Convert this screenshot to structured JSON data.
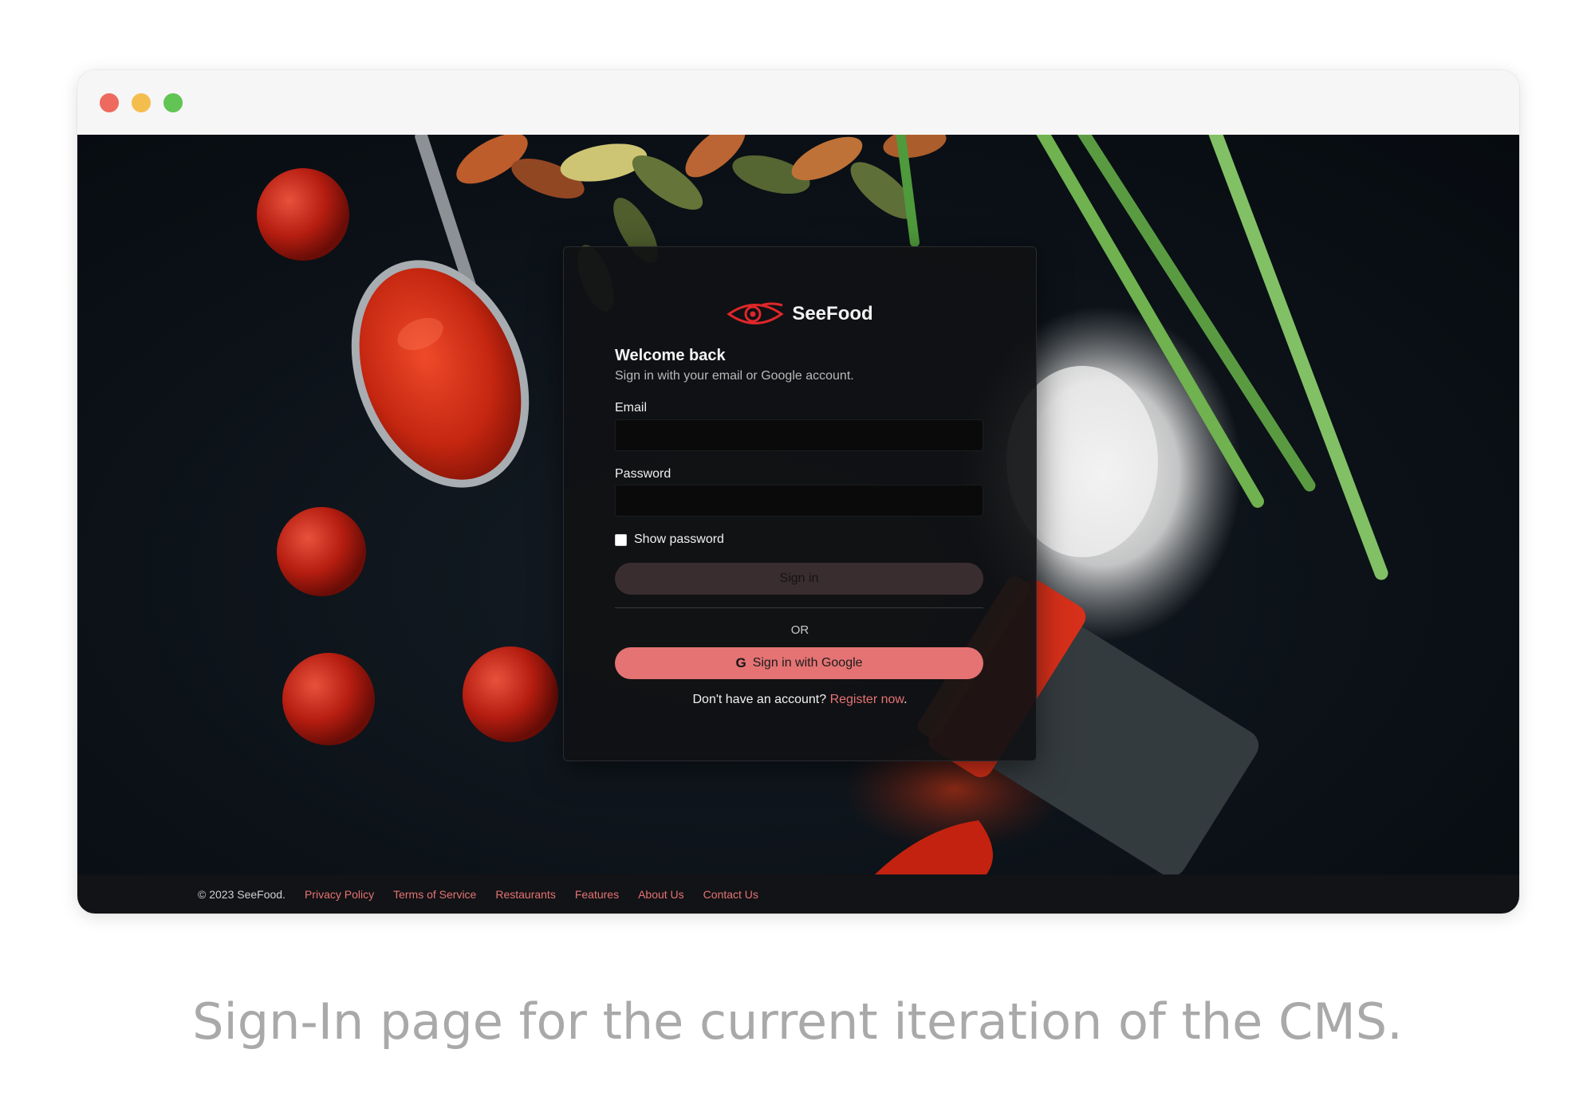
{
  "window_controls": {
    "close": "close",
    "minimize": "minimize",
    "zoom": "zoom"
  },
  "brand": {
    "name": "SeeFood",
    "accent": "#e57373",
    "logo_icon": "eye-logo-icon"
  },
  "login": {
    "title": "Welcome back",
    "subtitle": "Sign in with your email or Google account.",
    "email_label": "Email",
    "email_value": "",
    "password_label": "Password",
    "password_value": "",
    "show_password_label": "Show password",
    "show_password_checked": false,
    "signin_label": "Sign in",
    "or_label": "OR",
    "google_label": "Sign in with Google",
    "google_icon": "G",
    "no_account_text": "Don't have an account?",
    "register_link": "Register now",
    "register_suffix": "."
  },
  "footer": {
    "copyright": "© 2023 SeeFood.",
    "links": [
      "Privacy Policy",
      "Terms of Service",
      "Restaurants",
      "Features",
      "About Us",
      "Contact Us"
    ]
  },
  "caption": "Sign-In page for the current iteration of the CMS."
}
